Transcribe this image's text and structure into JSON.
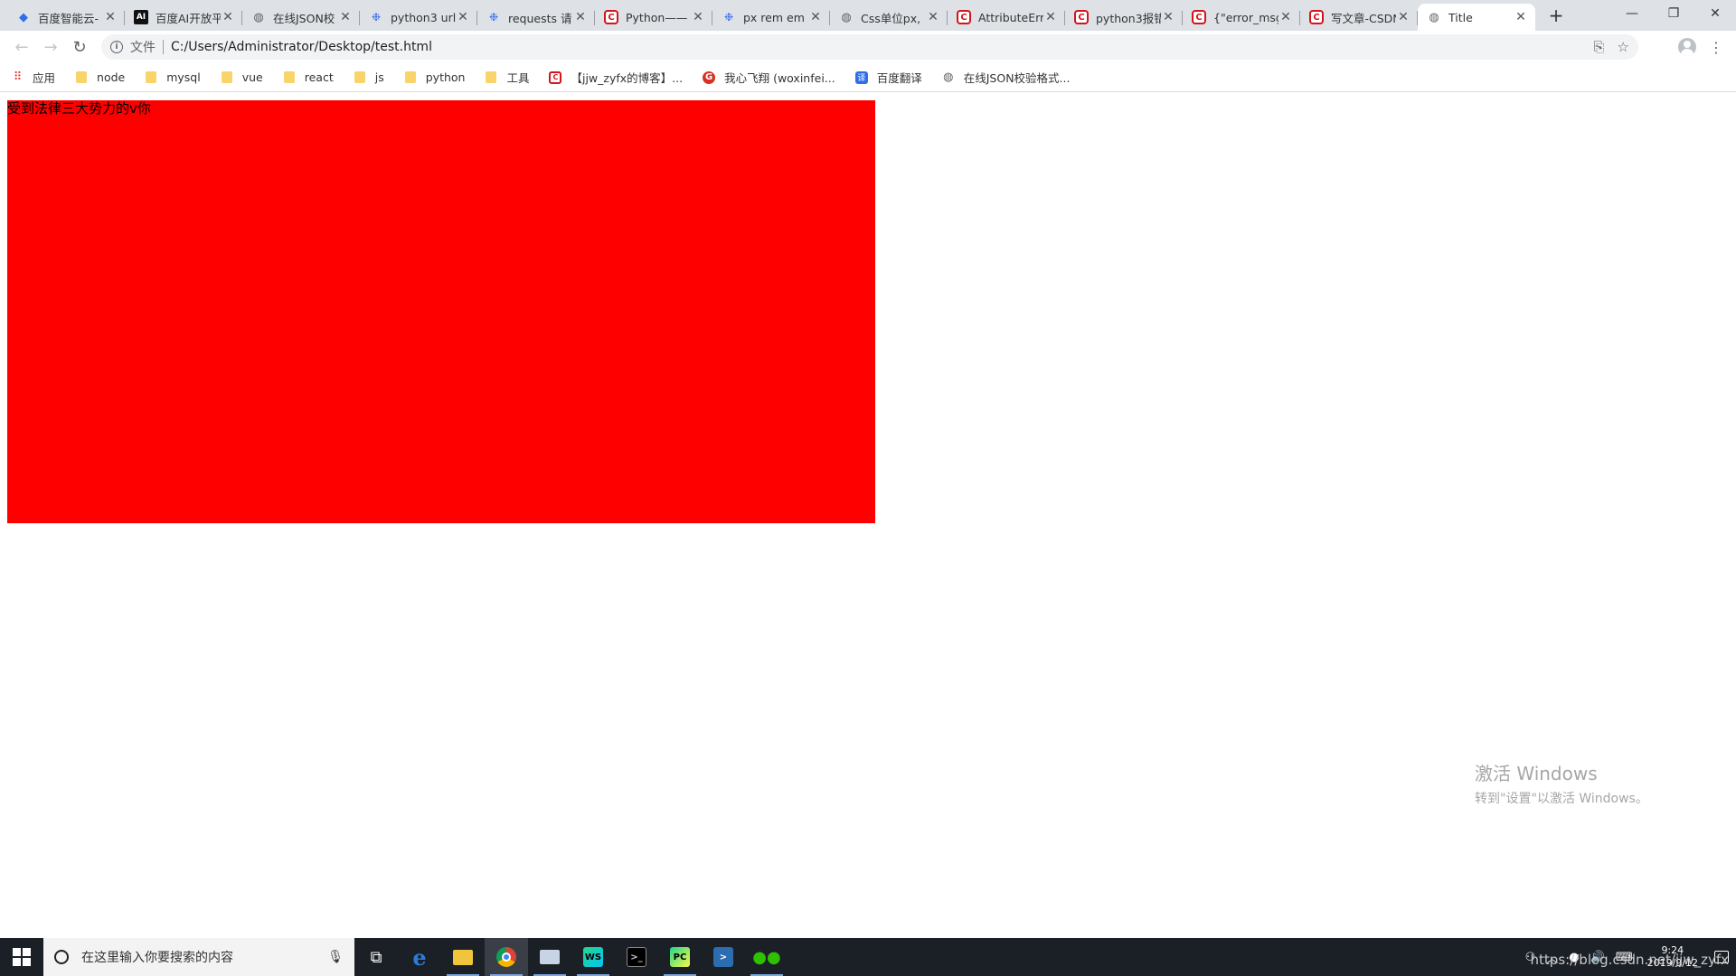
{
  "browser": {
    "tabs": [
      {
        "title": "百度智能云-",
        "icon": "cloud-icon"
      },
      {
        "title": "百度AI开放平",
        "icon": "ai-icon"
      },
      {
        "title": "在线JSON校",
        "icon": "globe-icon"
      },
      {
        "title": "python3 url",
        "icon": "baidu-paw-icon"
      },
      {
        "title": "requests 请",
        "icon": "baidu-paw-icon"
      },
      {
        "title": "Python——",
        "icon": "csdn-icon"
      },
      {
        "title": "px rem em",
        "icon": "baidu-paw-icon"
      },
      {
        "title": "Css单位px,",
        "icon": "globe-icon"
      },
      {
        "title": "AttributeErr",
        "icon": "csdn-icon"
      },
      {
        "title": "python3报错",
        "icon": "csdn-icon"
      },
      {
        "title": "{\"error_msg",
        "icon": "csdn-icon"
      },
      {
        "title": "写文章-CSDN",
        "icon": "csdn-icon"
      },
      {
        "title": "Title",
        "icon": "globe-icon",
        "active": true
      }
    ],
    "address": {
      "scheme_label": "文件",
      "url": "C:/Users/Administrator/Desktop/test.html"
    },
    "bookmarks": [
      {
        "label": "应用",
        "icon": "apps-grid-icon"
      },
      {
        "label": "node",
        "icon": "folder-icon"
      },
      {
        "label": "mysql",
        "icon": "folder-icon"
      },
      {
        "label": "vue",
        "icon": "folder-icon"
      },
      {
        "label": "react",
        "icon": "folder-icon"
      },
      {
        "label": "js",
        "icon": "folder-icon"
      },
      {
        "label": "python",
        "icon": "folder-icon"
      },
      {
        "label": "工具",
        "icon": "folder-icon"
      },
      {
        "label": "【jjw_zyfx的博客】...",
        "icon": "csdn-icon"
      },
      {
        "label": "我心飞翔 (woxinfei...",
        "icon": "g-icon"
      },
      {
        "label": "百度翻译",
        "icon": "translate-icon"
      },
      {
        "label": "在线JSON校验格式...",
        "icon": "globe-icon"
      }
    ]
  },
  "page": {
    "box_text": "受到法律三大势力的v你",
    "box_color": "#ff0000"
  },
  "watermark": {
    "title": "激活 Windows",
    "subtitle": "转到\"设置\"以激活 Windows。"
  },
  "taskbar": {
    "search_placeholder": "在这里输入你要搜索的内容",
    "clock_time": "9:24",
    "clock_date": "2019/9/12",
    "overlay": "https://blog.csdn.net/jjw_zyfx"
  }
}
